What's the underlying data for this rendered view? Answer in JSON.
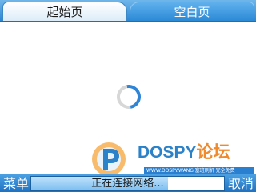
{
  "tabs": [
    {
      "label": "起始页",
      "active": false
    },
    {
      "label": "空白页",
      "active": true
    }
  ],
  "content": {
    "loading_indicator": "spinner-icon"
  },
  "watermark": {
    "brand_latin": "DOSPY",
    "brand_cn": "论坛",
    "sub": "WWW.DOSPY.WANG 塞班刷机 完全免费"
  },
  "bottom_bar": {
    "left_softkey": "菜单",
    "right_softkey": "取消",
    "status_text": "正在连接网络...",
    "progress": 0.71
  },
  "colors": {
    "accent": "#2b87d3",
    "tab_active_text": "#ffffff",
    "progress_fill": "#7cbef0"
  }
}
